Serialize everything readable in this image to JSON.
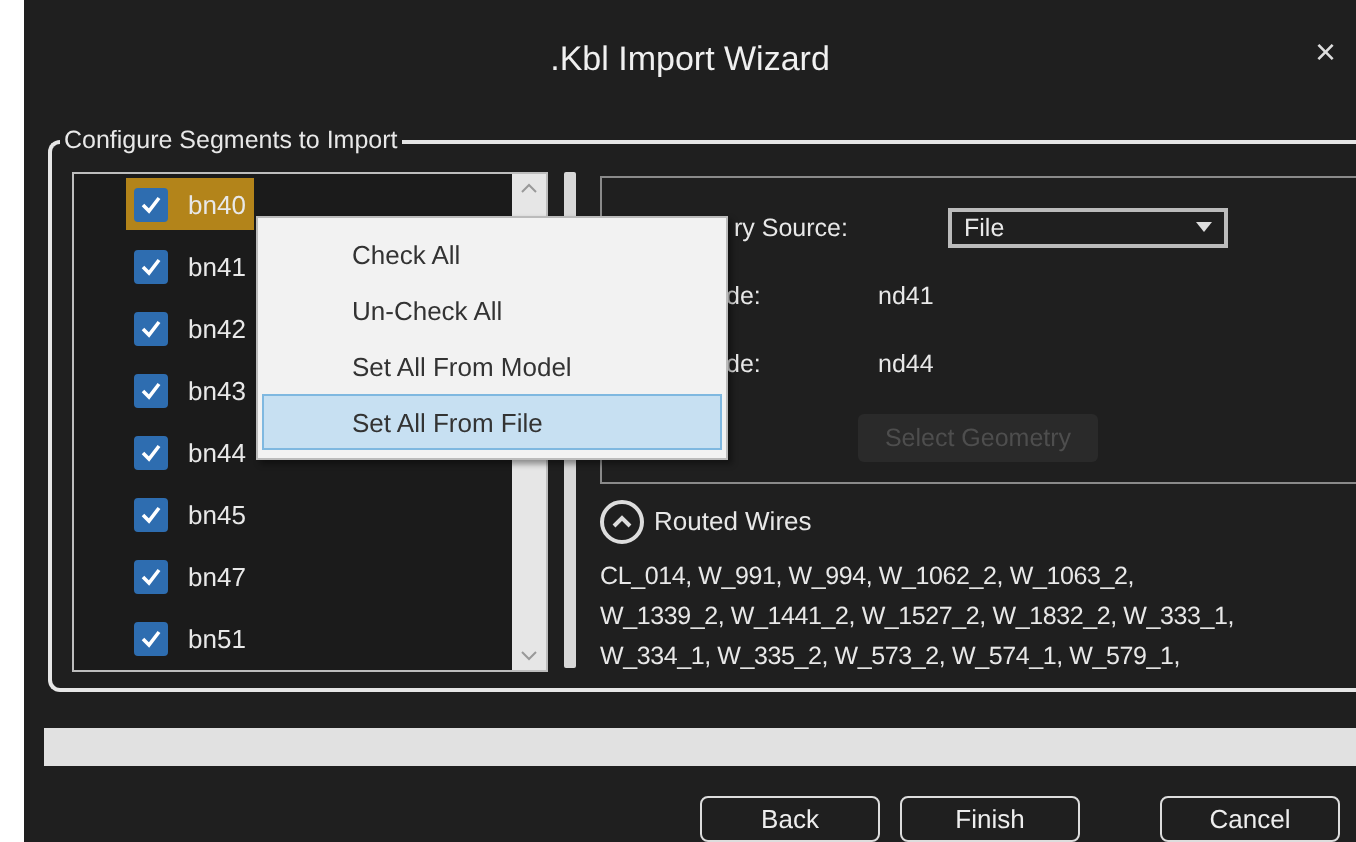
{
  "window": {
    "title": ".Kbl Import Wizard",
    "close": "×"
  },
  "group": {
    "title": "Configure Segments to Import"
  },
  "segments": [
    {
      "name": "bn40",
      "checked": true,
      "selected": true
    },
    {
      "name": "bn41",
      "checked": true,
      "selected": false
    },
    {
      "name": "bn42",
      "checked": true,
      "selected": false
    },
    {
      "name": "bn43",
      "checked": true,
      "selected": false
    },
    {
      "name": "bn44",
      "checked": true,
      "selected": false
    },
    {
      "name": "bn45",
      "checked": true,
      "selected": false
    },
    {
      "name": "bn47",
      "checked": true,
      "selected": false
    },
    {
      "name": "bn51",
      "checked": true,
      "selected": false
    }
  ],
  "context_menu": {
    "items": [
      {
        "label": "Check All",
        "selected": false
      },
      {
        "label": "Un-Check All",
        "selected": false
      },
      {
        "label": "Set All From Model",
        "selected": false
      },
      {
        "label": "Set All From File",
        "selected": true
      }
    ]
  },
  "geometry": {
    "fields": [
      {
        "kind": "dropdown",
        "label": "ry Source:",
        "value": "File"
      },
      {
        "kind": "text",
        "label": "de:",
        "value": "nd41"
      },
      {
        "kind": "text",
        "label": "de:",
        "value": "nd44"
      }
    ],
    "button": {
      "label": "Select Geometry",
      "disabled": true
    }
  },
  "routed_wires": {
    "title": "Routed Wires",
    "expanded": true,
    "lines": [
      "CL_014, W_991, W_994, W_1062_2, W_1063_2,",
      "W_1339_2, W_1441_2, W_1527_2, W_1832_2, W_333_1,",
      "W_334_1, W_335_2, W_573_2, W_574_1, W_579_1,"
    ]
  },
  "progress": {
    "level": 0
  },
  "buttons": [
    {
      "label": "Back"
    },
    {
      "label": "Finish"
    },
    {
      "label": "Cancel"
    }
  ]
}
